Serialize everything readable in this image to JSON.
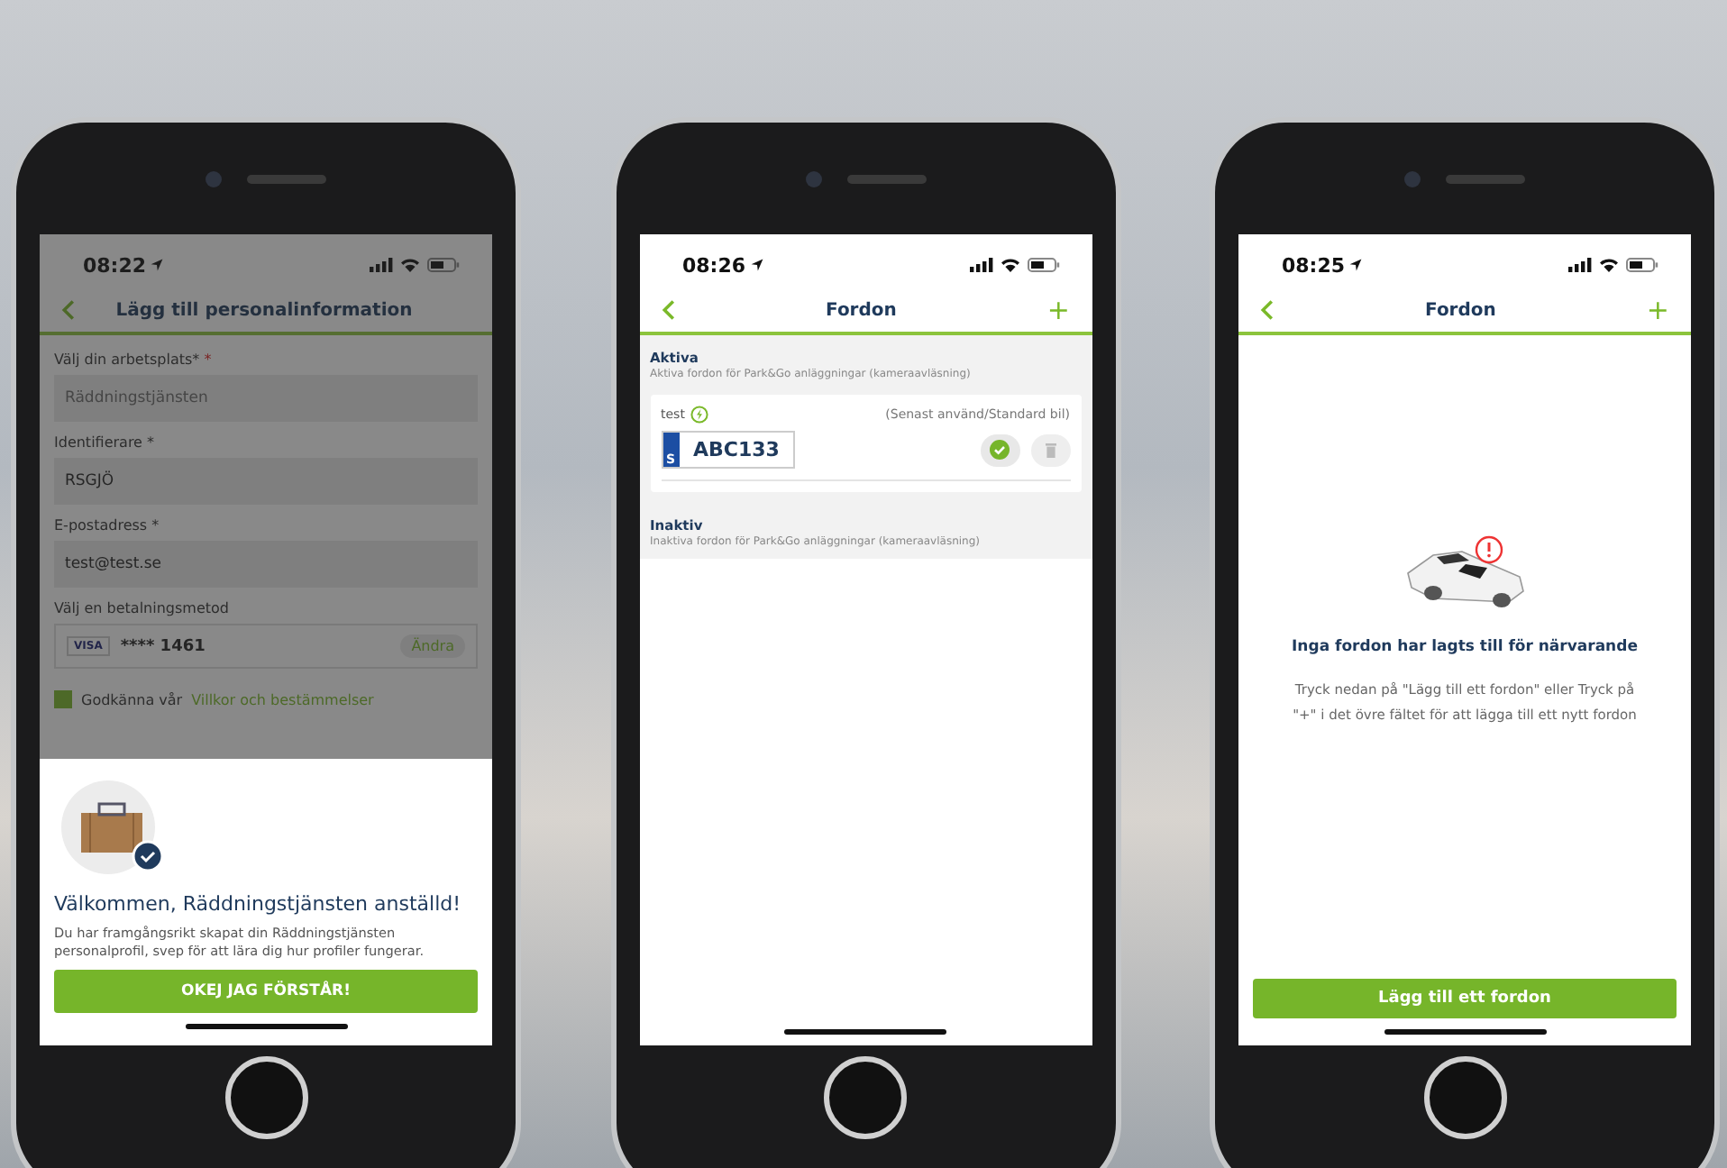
{
  "screen_profile": {
    "time": "08:22",
    "title": "Lägg till personalinformation",
    "fields": [
      {
        "label": "Välj din arbetsplats*",
        "required_mark": "*",
        "value": "Räddningstjänsten",
        "disabled": true
      },
      {
        "label": "Identifierare *",
        "value": "RSGJÖ",
        "disabled": false
      },
      {
        "label": "E-postadress *",
        "value": "test@test.se",
        "disabled": false
      }
    ],
    "payment": {
      "label": "Välj en betalningsmetod",
      "card_brand": "VISA",
      "number": "**** 1461",
      "action": "Ändra"
    },
    "terms": {
      "checked": true,
      "text": "Godkänna vår",
      "link": "Villkor och bestämmelser"
    },
    "sheet": {
      "title": "Välkommen, Räddningstjänsten anställd!",
      "body": "Du har framgångsrikt skapat din Räddningstjänsten personalprofil, svep för att lära dig hur profiler fungerar.",
      "button": "OKEJ JAG FÖRSTÅR!"
    }
  },
  "screen_vehicles": {
    "time": "08:26",
    "title": "Fordon",
    "add": "+",
    "sections": [
      {
        "title": "Aktiva",
        "subtitle": "Aktiva fordon för Park&Go anläggningar (kameraavläsning)",
        "vehicles": [
          {
            "name": "test",
            "note": "(Senast använd/Standard bil)",
            "country": "S",
            "plate": "ABC133",
            "selected": true
          }
        ]
      },
      {
        "title": "Inaktiv",
        "subtitle": "Inaktiva fordon för Park&Go anläggningar (kameraavläsning)"
      }
    ]
  },
  "screen_empty": {
    "time": "08:25",
    "title": "Fordon",
    "add": "+",
    "heading": "Inga fordon har lagts till för närvarande",
    "body": "Tryck nedan på \"Lägg till ett fordon\" eller Tryck på \"+\" i det övre fältet för att lägga till ett nytt fordon",
    "button": "Lägg till ett fordon"
  }
}
